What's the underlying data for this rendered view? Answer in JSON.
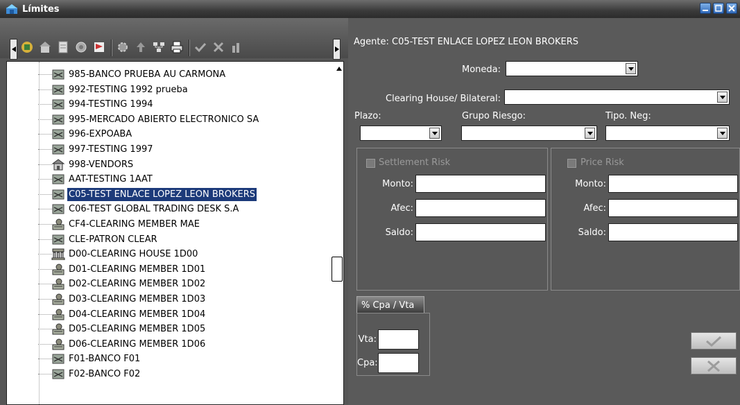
{
  "window": {
    "title": "Límites"
  },
  "tree": {
    "items": [
      {
        "label": "985-BANCO PRUEBA AU CARMONA",
        "icon": "agent-icon"
      },
      {
        "label": "992-TESTING 1992 prueba",
        "icon": "agent-icon"
      },
      {
        "label": "994-TESTING 1994",
        "icon": "agent-icon"
      },
      {
        "label": "995-MERCADO ABIERTO ELECTRONICO SA",
        "icon": "agent-icon"
      },
      {
        "label": "996-EXPOABA",
        "icon": "agent-icon"
      },
      {
        "label": "997-TESTING 1997",
        "icon": "agent-icon"
      },
      {
        "label": "998-VENDORS",
        "icon": "house-icon"
      },
      {
        "label": "AAT-TESTING 1AAT",
        "icon": "agent-icon"
      },
      {
        "label": "C05-TEST ENLACE LOPEZ LEON BROKERS",
        "icon": "agent-icon",
        "selected": true
      },
      {
        "label": "C06-TEST GLOBAL TRADING DESK S.A",
        "icon": "agent-icon"
      },
      {
        "label": "CF4-CLEARING MEMBER MAE",
        "icon": "clearing-member-icon"
      },
      {
        "label": "CLE-PATRON CLEAR",
        "icon": "agent-icon"
      },
      {
        "label": "D00-CLEARING HOUSE 1D00",
        "icon": "clearing-house-icon"
      },
      {
        "label": "D01-CLEARING MEMBER 1D01",
        "icon": "clearing-member-icon"
      },
      {
        "label": "D02-CLEARING MEMBER 1D02",
        "icon": "clearing-member-icon"
      },
      {
        "label": "D03-CLEARING MEMBER 1D03",
        "icon": "clearing-member-icon"
      },
      {
        "label": "D04-CLEARING MEMBER 1D04",
        "icon": "clearing-member-icon"
      },
      {
        "label": "D05-CLEARING MEMBER 1D05",
        "icon": "clearing-member-icon"
      },
      {
        "label": "D06-CLEARING MEMBER 1D06",
        "icon": "clearing-member-icon"
      },
      {
        "label": "F01-BANCO F01",
        "icon": "agent-icon"
      },
      {
        "label": "F02-BANCO F02",
        "icon": "agent-icon"
      }
    ]
  },
  "form": {
    "agente_label": "Agente: C05-TEST ENLACE LOPEZ LEON BROKERS",
    "moneda_label": "Moneda:",
    "moneda_value": "",
    "clearing_label": "Clearing House/ Bilateral:",
    "clearing_value": "",
    "plazo_label": "Plazo:",
    "plazo_value": "",
    "grupo_label": "Grupo Riesgo:",
    "grupo_value": "",
    "tipo_label": "Tipo. Neg:",
    "tipo_value": ""
  },
  "settlement": {
    "title": "Settlement Risk",
    "checked": false,
    "monto_label": "Monto:",
    "afec_label": "Afec:",
    "saldo_label": "Saldo:",
    "monto": "",
    "afec": "",
    "saldo": ""
  },
  "price": {
    "title": "Price Risk",
    "checked": false,
    "monto_label": "Monto:",
    "afec_label": "Afec:",
    "saldo_label": "Saldo:",
    "monto": "",
    "afec": "",
    "saldo": ""
  },
  "pct": {
    "title": "% Cpa / Vta",
    "vta_label": "Vta:",
    "cpa_label": "Cpa:",
    "vta": "",
    "cpa": ""
  },
  "actions": {
    "ok_icon": "checkmark-icon",
    "cancel_icon": "x-icon"
  },
  "toolbar": {
    "icons": [
      "agent-icon",
      "house-icon",
      "document-icon",
      "globe-icon",
      "flag-icon",
      "gear-icon",
      "upload-icon",
      "hierarchy-icon",
      "print-icon",
      "check-icon",
      "x-icon",
      "chart-icon"
    ]
  },
  "colors": {
    "selection": "#1c3a7a",
    "panel_bg": "#585858",
    "title_bar": "#3a3a3a"
  }
}
